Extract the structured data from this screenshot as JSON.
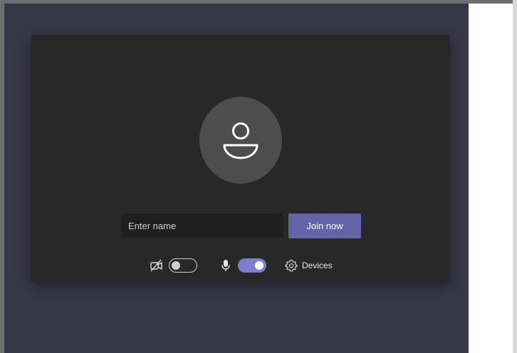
{
  "prejoin": {
    "name_input": {
      "placeholder": "Enter name",
      "value": ""
    },
    "join_button": {
      "label": "Join now"
    },
    "controls": {
      "camera": {
        "icon": "camera-off-icon",
        "state": "off"
      },
      "microphone": {
        "icon": "microphone-icon",
        "state": "on"
      },
      "devices": {
        "icon": "gear-icon",
        "label": "Devices"
      }
    },
    "colors": {
      "app_background": "#393849",
      "panel_background": "#282828",
      "accent": "#6264a7",
      "toggle_on": "#7b7fd0"
    }
  }
}
